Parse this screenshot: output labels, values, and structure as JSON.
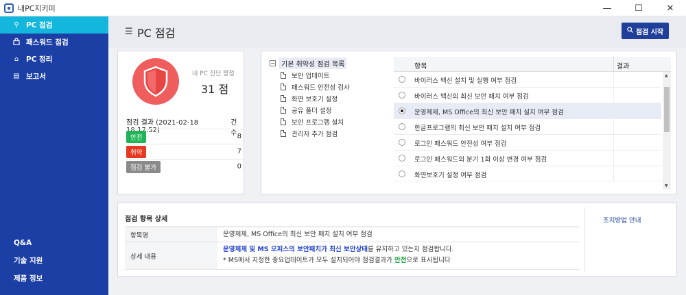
{
  "window": {
    "title": "내PC지키미",
    "controls": {
      "minimize": "—",
      "maximize": "☐",
      "close": "✕"
    }
  },
  "sidebar": {
    "items": [
      {
        "label": "PC 점검",
        "icon": "search-icon",
        "glyph": "⚲",
        "active": true
      },
      {
        "label": "패스워드 점검",
        "icon": "lock-icon",
        "glyph": "🔒",
        "active": false
      },
      {
        "label": "PC 정리",
        "icon": "broom-icon",
        "glyph": "⌂",
        "active": false
      },
      {
        "label": "보고서",
        "icon": "report-icon",
        "glyph": "▤",
        "active": false
      }
    ],
    "bottom_links": [
      "Q&A",
      "기술 지원",
      "제품 정보"
    ]
  },
  "header": {
    "menu_glyph": "☰",
    "title": "PC 점검",
    "start_button": "점검 시작"
  },
  "score": {
    "label": "내 PC 진단 평점",
    "value": "31 점",
    "result_header": "점검 결과 (2021-02-18 18:17:52)",
    "count_header": "건수",
    "rows": [
      {
        "badge": "안전",
        "color": "#1fb455",
        "count": "8"
      },
      {
        "badge": "취약",
        "color": "#e6391f",
        "count": "7"
      },
      {
        "badge": "점검 불가",
        "color": "#8a8a8a",
        "count": "0"
      }
    ]
  },
  "tree": {
    "root": "기본 취약성 점검 목록",
    "toggle": "−",
    "items": [
      "보안 업데이트",
      "패스워드 안전성 검사",
      "화면 보호기 설정",
      "공유 폴더 설정",
      "보안 프로그램 설치",
      "관리자 추가 점검"
    ]
  },
  "table": {
    "headers": {
      "item": "항목",
      "result": "결과"
    },
    "rows": [
      {
        "text": "바이러스 백신 설치 및 실행 여부 점검",
        "selected": false
      },
      {
        "text": "바이러스 백신의 최신 보안 패치 여부 점검",
        "selected": false
      },
      {
        "text": "운영체제, MS Office의 최신 보안 패치 설치 여부 점검",
        "selected": true
      },
      {
        "text": "한글프로그램의 최신 보안 패치 설치 여부 점검",
        "selected": false
      },
      {
        "text": "로그인 패스워드 안전성 여부 점검",
        "selected": false
      },
      {
        "text": "로그인 패스워드의 분기 1회 이상 변경 여부 점검",
        "selected": false
      },
      {
        "text": "화면보호기 설정 여부 점검",
        "selected": false
      }
    ],
    "scroll": {
      "up": "▲",
      "down": "▼"
    }
  },
  "details": {
    "title": "점검 항목 상세",
    "guide_link": "조치방법 안내",
    "item_label": "항목명",
    "item_value": "운영체제, MS Office의 최신 보안 패치 설치 여부 점검",
    "content_label": "상세 내용",
    "content_line1_highlight": "운영체제 및 MS 오피스의 보안패치가 최신 보안상태",
    "content_line1_rest": "를 유지하고 있는지 점검합니다.",
    "content_line2_pre": "* MS에서 지정한 중요업데이트가 모두 설치되어야 점검결과가 ",
    "content_line2_highlight": "안전",
    "content_line2_post": "으로 표시됩니다"
  }
}
